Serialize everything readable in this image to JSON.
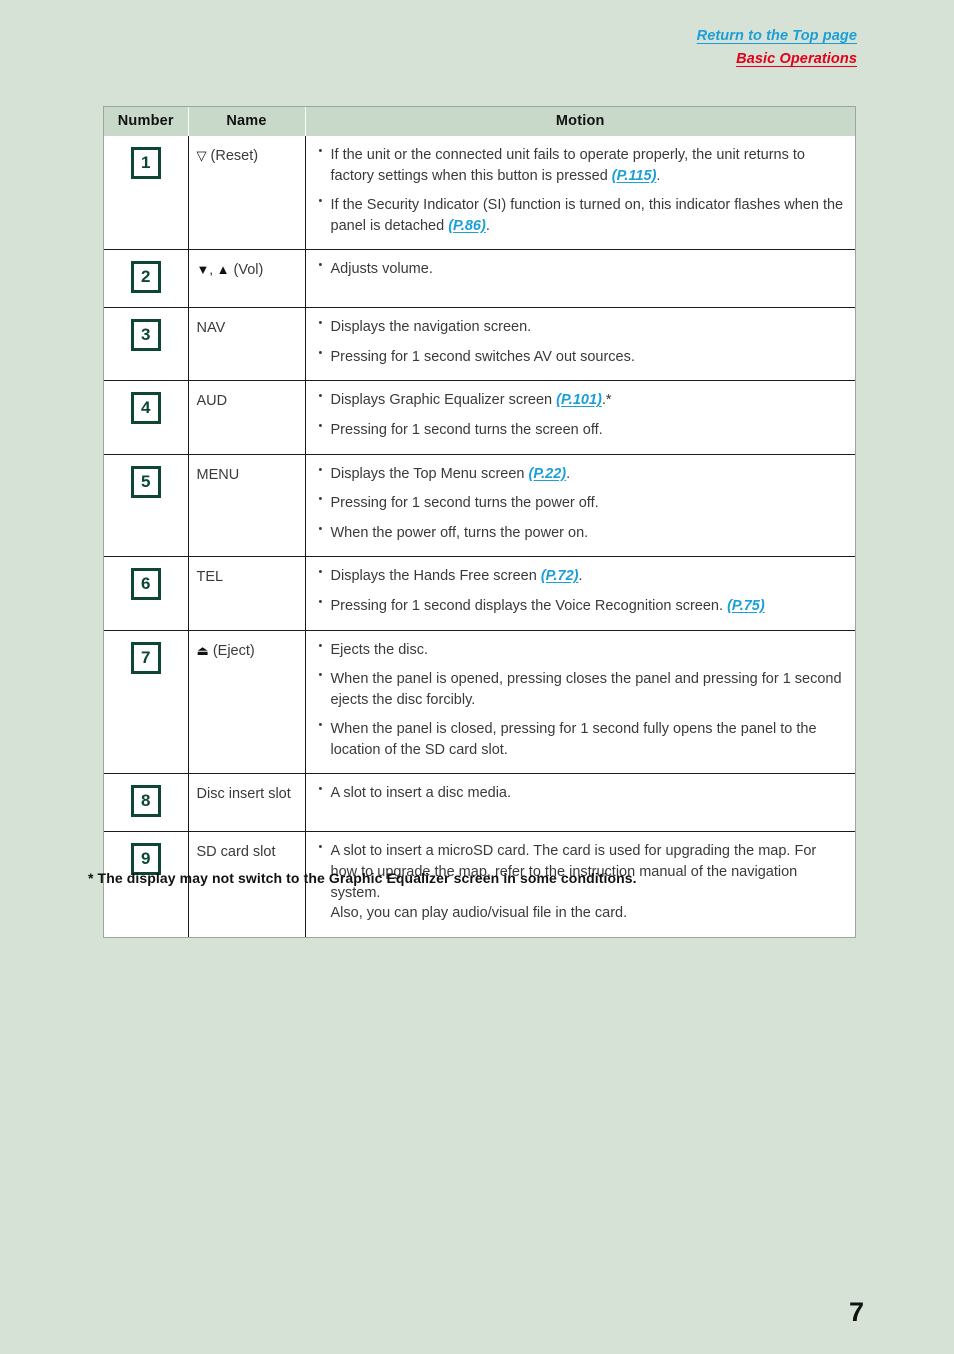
{
  "header": {
    "top_link": "Return to the Top page",
    "section_link": "Basic Operations",
    "top_link_color": "#1b9fd8",
    "section_link_color": "#e2001a"
  },
  "table": {
    "columns": [
      "Number",
      "Name",
      "Motion"
    ],
    "rows": [
      {
        "number": "1",
        "name_symbol": "▽",
        "name_text": "(Reset)",
        "motion": [
          {
            "pre": "If the unit or the connected unit fails to operate properly, the unit returns to factory settings when this button is pressed ",
            "ref": "(P.115)",
            "post": "."
          },
          {
            "pre": "If the Security Indicator (SI) function is turned on, this indicator flashes when the panel is detached ",
            "ref": "(P.86)",
            "post": "."
          }
        ]
      },
      {
        "number": "2",
        "name_symbol": "▼, ▲",
        "name_text": "(Vol)",
        "motion": [
          {
            "pre": "Adjusts volume.",
            "ref": "",
            "post": ""
          }
        ]
      },
      {
        "number": "3",
        "name_symbol": "",
        "name_text": "NAV",
        "motion": [
          {
            "pre": "Displays the navigation screen.",
            "ref": "",
            "post": ""
          },
          {
            "pre": "Pressing for 1 second switches AV out sources.",
            "ref": "",
            "post": ""
          }
        ]
      },
      {
        "number": "4",
        "name_symbol": "",
        "name_text": "AUD",
        "motion": [
          {
            "pre": "Displays Graphic Equalizer screen ",
            "ref": "(P.101)",
            "post": ".*"
          },
          {
            "pre": "Pressing for 1 second turns the screen off.",
            "ref": "",
            "post": ""
          }
        ]
      },
      {
        "number": "5",
        "name_symbol": "",
        "name_text": "MENU",
        "motion": [
          {
            "pre": "Displays the Top Menu screen ",
            "ref": "(P.22)",
            "post": "."
          },
          {
            "pre": "Pressing for 1 second turns the power off.",
            "ref": "",
            "post": ""
          },
          {
            "pre": "When the power off, turns the power on.",
            "ref": "",
            "post": ""
          }
        ]
      },
      {
        "number": "6",
        "name_symbol": "",
        "name_text": "TEL",
        "motion": [
          {
            "pre": "Displays the Hands Free screen ",
            "ref": "(P.72)",
            "post": "."
          },
          {
            "pre": "Pressing for 1 second displays the Voice Recognition screen. ",
            "ref": "(P.75)",
            "post": ""
          }
        ]
      },
      {
        "number": "7",
        "name_symbol": "⏏",
        "name_text": "(Eject)",
        "motion": [
          {
            "pre": "Ejects the disc.",
            "ref": "",
            "post": ""
          },
          {
            "pre": "When the panel is opened, pressing closes the panel and pressing for 1 second ejects the disc forcibly.",
            "ref": "",
            "post": ""
          },
          {
            "pre": "When the panel is closed, pressing for 1 second fully opens the panel to the location of the SD card slot.",
            "ref": "",
            "post": ""
          }
        ]
      },
      {
        "number": "8",
        "name_symbol": "",
        "name_text": "Disc insert slot",
        "motion": [
          {
            "pre": "A slot to insert a disc media.",
            "ref": "",
            "post": ""
          }
        ]
      },
      {
        "number": "9",
        "name_symbol": "",
        "name_text": "SD card slot",
        "motion": [
          {
            "pre": "A slot to insert a microSD card. The card is used for upgrading the map. For how to upgrade the map, refer to the instruction manual of the navigation system.\nAlso, you can play audio/visual file in the card.",
            "ref": "",
            "post": ""
          }
        ]
      }
    ]
  },
  "footnote": "* The display may not switch to the Graphic Equalizer screen in some conditions.",
  "page_number": "7"
}
